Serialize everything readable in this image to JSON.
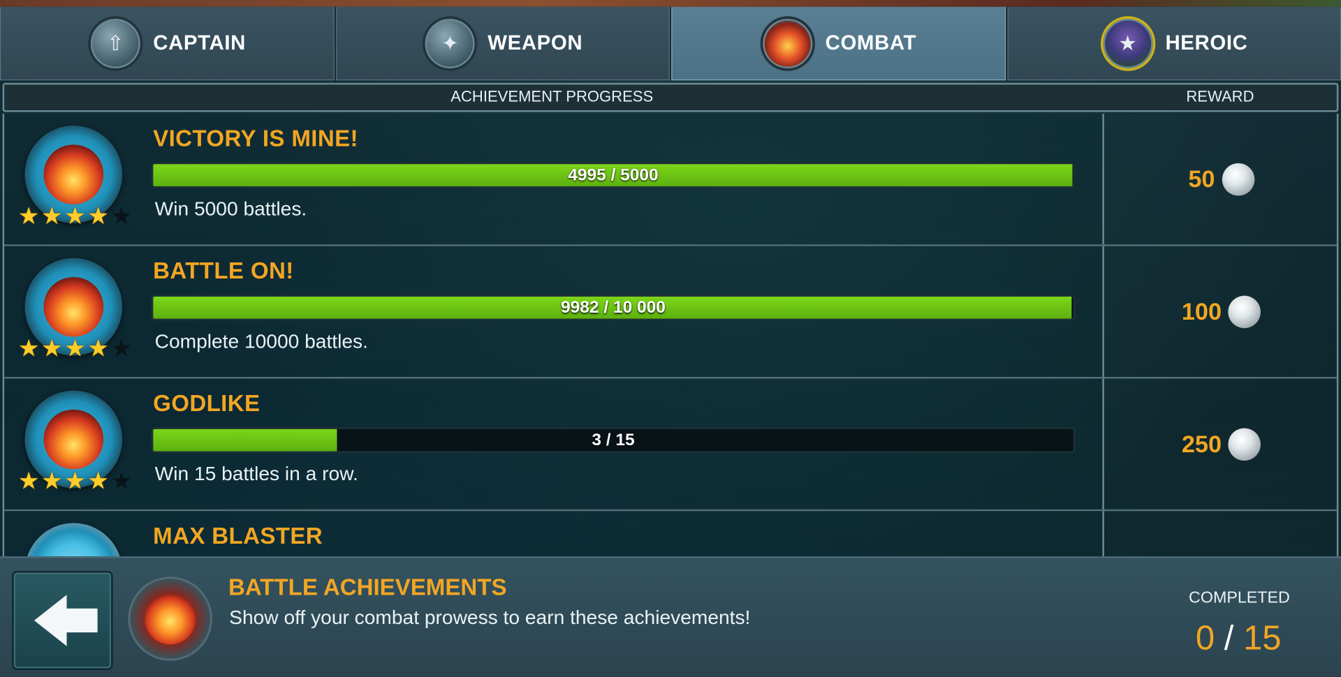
{
  "tabs": [
    {
      "label": "CAPTAIN",
      "icon": "captain-badge-icon",
      "active": false
    },
    {
      "label": "WEAPON",
      "icon": "weapon-icon",
      "active": false
    },
    {
      "label": "COMBAT",
      "icon": "combat-explosion-icon",
      "active": true
    },
    {
      "label": "HEROIC",
      "icon": "heroic-star-icon",
      "active": false
    }
  ],
  "header": {
    "progress": "ACHIEVEMENT PROGRESS",
    "reward": "REWARD"
  },
  "achievements": [
    {
      "title": "VICTORY IS MINE!",
      "progress_text": "4995 / 5000",
      "progress_fraction": 0.999,
      "description": "Win 5000 battles.",
      "reward": "50",
      "stars": 4
    },
    {
      "title": "BATTLE ON!",
      "progress_text": "9982 / 10 000",
      "progress_fraction": 0.998,
      "description": "Complete 10000 battles.",
      "reward": "100",
      "stars": 4
    },
    {
      "title": "GODLIKE",
      "progress_text": "3 / 15",
      "progress_fraction": 0.2,
      "description": "Win 15 battles in a row.",
      "reward": "250",
      "stars": 4
    },
    {
      "title": "MAX BLASTER"
    }
  ],
  "footer": {
    "title": "BATTLE ACHIEVEMENTS",
    "description": "Show off your combat prowess to earn these achievements!",
    "completed_label": "COMPLETED",
    "completed": "0",
    "separator": "/",
    "total": "15"
  },
  "colors": {
    "accent": "#f2a623",
    "progress": "#6cc414",
    "panel": "#304653"
  }
}
